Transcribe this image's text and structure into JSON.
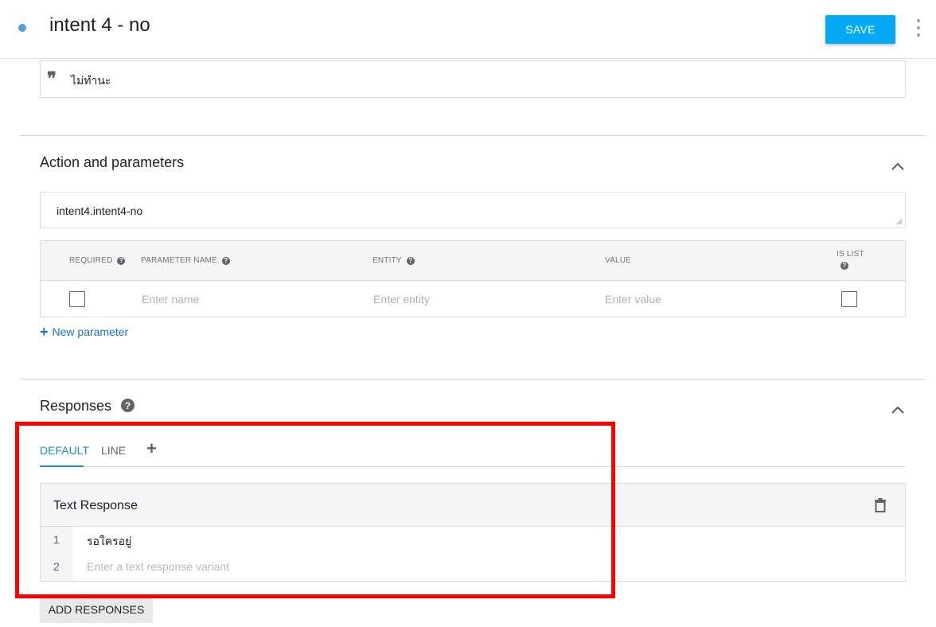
{
  "header": {
    "title": "intent 4 - no",
    "save_label": "SAVE"
  },
  "training_phrase": {
    "text": "ไม่ทำนะ"
  },
  "action_section": {
    "title": "Action and parameters",
    "action_value": "intent4.intent4-no",
    "table": {
      "headers": {
        "required": "REQUIRED",
        "parameter_name": "PARAMETER NAME",
        "entity": "ENTITY",
        "value": "VALUE",
        "is_list": "IS LIST"
      },
      "placeholders": {
        "name": "Enter name",
        "entity": "Enter entity",
        "value": "Enter value"
      }
    },
    "new_parameter_label": "New parameter"
  },
  "responses_section": {
    "title": "Responses",
    "tabs": [
      {
        "label": "DEFAULT",
        "active": true
      },
      {
        "label": "LINE",
        "active": false
      }
    ],
    "text_response": {
      "title": "Text Response",
      "rows": [
        {
          "num": "1",
          "value": "รอใครอยู่"
        },
        {
          "num": "2",
          "placeholder": "Enter a text response variant"
        }
      ]
    },
    "add_responses_label": "ADD RESPONSES"
  },
  "colors": {
    "accent": "#03a9f4",
    "tab_active": "#1a8fc8",
    "link": "#1a73b8",
    "highlight": "#ff0000"
  },
  "icons": [
    "status-dot-icon",
    "more-vert-icon",
    "quote-icon",
    "chevron-up-icon",
    "help-icon",
    "plus-icon",
    "trash-icon",
    "resize-handle-icon"
  ]
}
